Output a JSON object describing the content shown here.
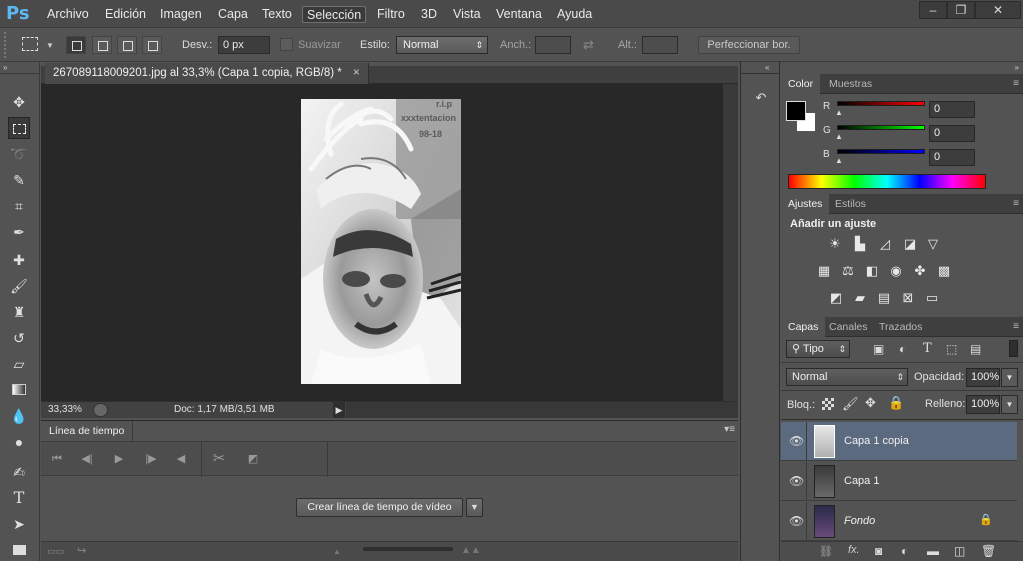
{
  "app": {
    "logo": "Ps",
    "menu": [
      "Archivo",
      "Edición",
      "Imagen",
      "Capa",
      "Texto",
      "Selección",
      "Filtro",
      "3D",
      "Vista",
      "Ventana",
      "Ayuda"
    ],
    "window_buttons": [
      "–",
      "❐",
      "✕"
    ]
  },
  "options": {
    "desv_label": "Desv.:",
    "desv_value": "0 px",
    "suavizar_label": "Suavizar",
    "estilo_label": "Estilo:",
    "estilo_value": "Normal",
    "anch_label": "Anch.:",
    "alt_label": "Alt.:",
    "perfeccionar": "Perfeccionar bor."
  },
  "document": {
    "tab_title": "267089118009201.jpg al 33,3% (Capa 1 copia, RGB/8) *",
    "close_glyph": "×",
    "zoom": "33,33%",
    "doc_info": "Doc: 1,17 MB/3,51 MB",
    "watermark_lines": [
      "r.i.p",
      "xxxtentacion",
      "98-18"
    ]
  },
  "timeline": {
    "tab": "Línea de tiempo",
    "create_button": "Crear línea de tiempo de vídeo"
  },
  "color_panel": {
    "tabs": [
      "Color",
      "Muestras"
    ],
    "channels": [
      {
        "label": "R",
        "value": "0",
        "color": "#ff0000"
      },
      {
        "label": "G",
        "value": "0",
        "color": "#00ff00"
      },
      {
        "label": "B",
        "value": "0",
        "color": "#0000ff"
      }
    ]
  },
  "adjustments_panel": {
    "tabs": [
      "Ajustes",
      "Estilos"
    ],
    "heading": "Añadir un ajuste"
  },
  "layers_panel": {
    "tabs": [
      "Capas",
      "Canales",
      "Trazados"
    ],
    "filter_label": "Tipo",
    "blend_mode": "Normal",
    "opacity_label": "Opacidad:",
    "opacity_value": "100%",
    "lock_label": "Bloq.:",
    "fill_label": "Relleno:",
    "fill_value": "100%",
    "layers": [
      {
        "name": "Capa 1 copia",
        "selected": true
      },
      {
        "name": "Capa 1",
        "selected": false
      },
      {
        "name": "Fondo",
        "selected": false,
        "locked": true
      }
    ]
  }
}
